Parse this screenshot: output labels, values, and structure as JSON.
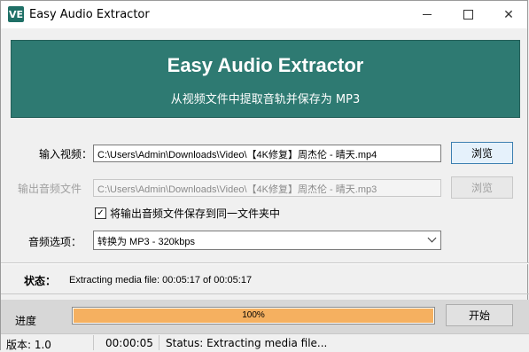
{
  "window": {
    "icon_text": "VE",
    "title": "Easy Audio Extractor"
  },
  "banner": {
    "title": "Easy Audio Extractor",
    "subtitle": "从视频文件中提取音轨并保存为 MP3"
  },
  "form": {
    "input_label": "输入视频：",
    "input_value": "C:\\Users\\Admin\\Downloads\\Video\\【4K修复】周杰伦 - 晴天.mp4",
    "browse_label": "浏览",
    "output_label": "输出音频文件",
    "output_value": "C:\\Users\\Admin\\Downloads\\Video\\【4K修复】周杰伦 - 晴天.mp3",
    "output_browse_label": "浏览",
    "same_folder_checkbox_label": "将输出音频文件保存到同一文件夹中",
    "same_folder_checked": true,
    "audio_option_label": "音频选项：",
    "audio_option_value": "转换为 MP3 - 320kbps"
  },
  "status": {
    "label": "状态：",
    "text": "Extracting media file: 00:05:17 of 00:05:17"
  },
  "progress": {
    "label": "进度",
    "percent": 100,
    "percent_text": "100%",
    "start_button": "开始",
    "fill_color": "#f5b060"
  },
  "statusbar": {
    "version": "版本: 1.0",
    "elapsed": "00:00:05",
    "status": "Status: Extracting media file..."
  },
  "colors": {
    "banner_bg": "#2e7a72"
  }
}
